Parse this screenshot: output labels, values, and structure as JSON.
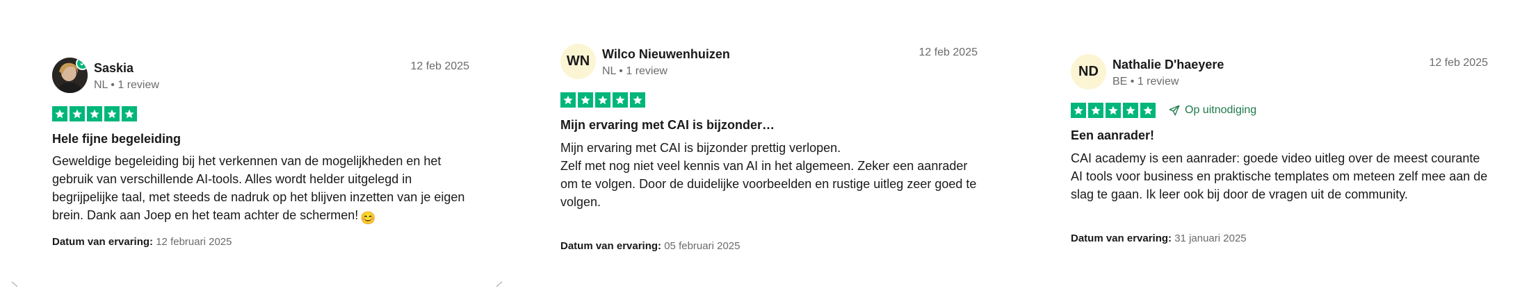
{
  "colors": {
    "star_green": "#00b67a",
    "invite_green": "#1f7a4a",
    "muted": "#6b6b6b",
    "avatar_bg": "#fcf5d4"
  },
  "reviews": [
    {
      "avatar_type": "photo",
      "name": "Saskia",
      "meta": "NL • 1 review",
      "date": "12 feb 2025",
      "rating": 5,
      "title": "Hele fijne begeleiding",
      "body": "Geweldige begeleiding bij het verkennen van de mogelijkheden en het gebruik van verschillende AI-tools. Alles wordt helder uitgelegd in begrijpelijke taal, met steeds de nadruk op het blijven inzetten van je eigen brein. Dank aan Joep en het team achter de schermen!",
      "emoji": "😊",
      "exp_label": "Datum van ervaring:",
      "exp_value": "12 februari 2025"
    },
    {
      "avatar_type": "initials",
      "initials": "WN",
      "name": "Wilco Nieuwenhuizen",
      "meta": "NL • 1 review",
      "date": "12 feb 2025",
      "rating": 5,
      "title": "Mijn ervaring met CAI is bijzonder…",
      "body_lines": [
        "Mijn ervaring met CAI is bijzonder prettig verlopen.",
        "Zelf met nog niet veel kennis van AI in het algemeen. Zeker een aanrader om te volgen. Door de duidelijke voorbeelden en rustige uitleg zeer goed te volgen."
      ],
      "exp_label": "Datum van ervaring:",
      "exp_value": "05 februari 2025"
    },
    {
      "avatar_type": "initials",
      "initials": "ND",
      "name": "Nathalie D'haeyere",
      "meta": "BE • 1 review",
      "date": "12 feb 2025",
      "rating": 5,
      "invite_label": "Op uitnodiging",
      "title": "Een aanrader!",
      "body": "CAI academy is een aanrader: goede video uitleg over de meest courante AI tools voor business en praktische templates om meteen zelf mee aan de slag te gaan. Ik leer ook bij door de vragen uit de community.",
      "exp_label": "Datum van ervaring:",
      "exp_value": "31 januari 2025"
    }
  ]
}
